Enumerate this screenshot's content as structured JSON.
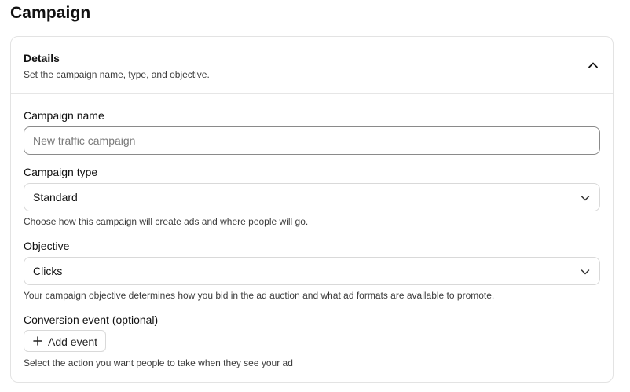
{
  "page": {
    "title": "Campaign"
  },
  "details": {
    "title": "Details",
    "subtitle": "Set the campaign name, type, and objective.",
    "collapse_icon": "chevron-up-icon"
  },
  "form": {
    "campaign_name": {
      "label": "Campaign name",
      "placeholder": "New traffic campaign",
      "value": ""
    },
    "campaign_type": {
      "label": "Campaign type",
      "value": "Standard",
      "helper": "Choose how this campaign will create ads and where people will go."
    },
    "objective": {
      "label": "Objective",
      "value": "Clicks",
      "helper": "Your campaign objective determines how you bid in the ad auction and what ad formats are available to promote."
    },
    "conversion_event": {
      "label": "Conversion event (optional)",
      "button_label": "Add event",
      "helper": "Select the action you want people to take when they see your ad"
    }
  },
  "icons": {
    "dropdown": "chevron-down-icon",
    "add": "plus-icon"
  }
}
